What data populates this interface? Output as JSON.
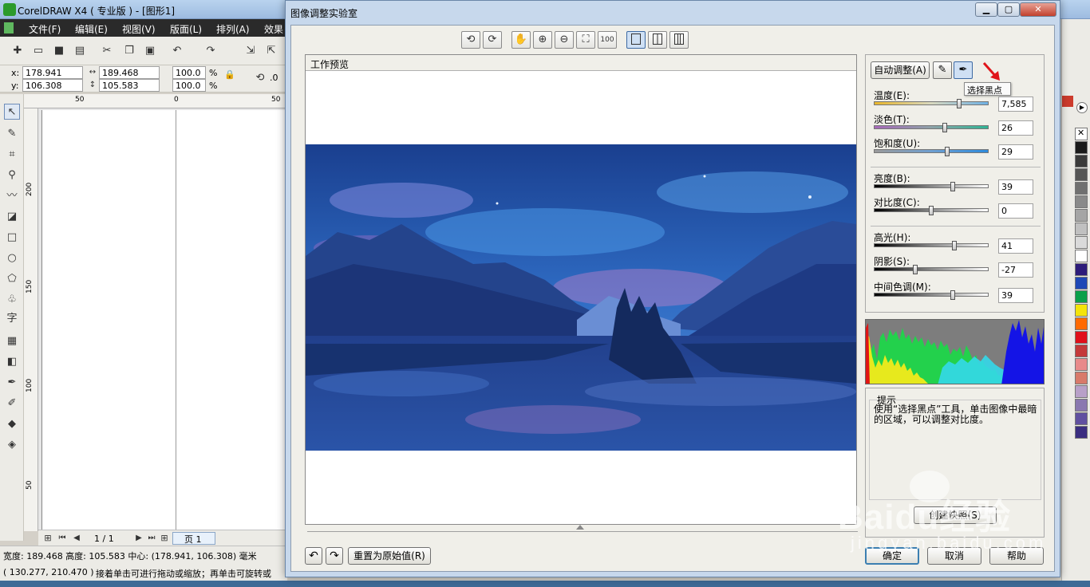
{
  "app": {
    "title": "CorelDRAW X4 ( 专业版 ) - [图形1]",
    "menu": [
      "文件(F)",
      "编辑(E)",
      "视图(V)",
      "版面(L)",
      "排列(A)",
      "效果"
    ],
    "properties": {
      "x_label": "x:",
      "x_value": "178.941 mm",
      "y_label": "y:",
      "y_value": "106.308 mm",
      "w_value": "189.468 mm",
      "h_value": "105.583 mm",
      "scale_w": "100.0",
      "scale_h": "100.0",
      "pct": "%",
      "rotate": ".0"
    },
    "ruler_h": [
      "50",
      "0",
      "50"
    ],
    "ruler_v": [
      "200",
      "150",
      "100",
      "50"
    ],
    "page_nav": "1 / 1",
    "page_tab": "页 1",
    "status_line1": "宽度: 189.468 高度: 105.583 中心: (178.941, 106.308) 毫米",
    "status_line2_coords": "( 130.277, 210.470 )",
    "status_line2_msg": "接着单击可进行拖动或缩放；再单击可旋转或"
  },
  "dialog": {
    "title": "图像调整实验室",
    "preview_label": "工作预览",
    "auto_adjust": "自动调整(A)",
    "tooltip": "选择黑点",
    "sliders": [
      {
        "label": "温度(E):",
        "value": "7,585",
        "level": 0.74,
        "gradient": "linear-gradient(90deg,#e8b62c,#d9d9c0,#6fb1e4)"
      },
      {
        "label": "淡色(T):",
        "value": "26",
        "level": 0.62,
        "gradient": "linear-gradient(90deg,#a668b8,#8ea2a8,#2fb494)"
      },
      {
        "label": "饱和度(U):",
        "value": "29",
        "level": 0.64,
        "gradient": "linear-gradient(90deg,#9a9a9a,#6f9fd0,#2e8bdc)"
      },
      {
        "label": "亮度(B):",
        "value": "39",
        "level": 0.69,
        "gradient": "linear-gradient(90deg,#000,#888,#fff)"
      },
      {
        "label": "对比度(C):",
        "value": "0",
        "level": 0.5,
        "gradient": "linear-gradient(90deg,#000,#888,#fff)"
      },
      {
        "label": "高光(H):",
        "value": "41",
        "level": 0.7,
        "gradient": "linear-gradient(90deg,#000,#888,#fff)"
      },
      {
        "label": "阴影(S):",
        "value": "-27",
        "level": 0.36,
        "gradient": "linear-gradient(90deg,#000,#888,#fff)"
      },
      {
        "label": "中间色调(M):",
        "value": "39",
        "level": 0.69,
        "gradient": "linear-gradient(90deg,#000,#888,#fff)"
      }
    ],
    "hint_title": "提示",
    "hint_text": "使用“选择黑点”工具，单击图像中最暗的区域，可以调整对比度。",
    "snapshot_button": "创建快照(S)",
    "reset_button": "重置为原始值(R)",
    "ok_button": "确定",
    "cancel_button": "取消",
    "help_button": "帮助"
  },
  "watermark": {
    "brand": "Baidu经验",
    "sub": "jingyan.baidu.com"
  },
  "palette_colors": [
    "#1a1a1a",
    "#3a3a3a",
    "#555555",
    "#707070",
    "#8a8a8a",
    "#a5a5a5",
    "#c0c0c0",
    "#dadada",
    "#ffffff",
    "#2d1c7a",
    "#1f48b6",
    "#0aa04a",
    "#f4e40a",
    "#ff6a00",
    "#e0101a",
    "#c43a3a",
    "#e88a8a",
    "#d87a6a",
    "#b8a0c8",
    "#8a78b0",
    "#6050a0",
    "#3a2e80"
  ]
}
